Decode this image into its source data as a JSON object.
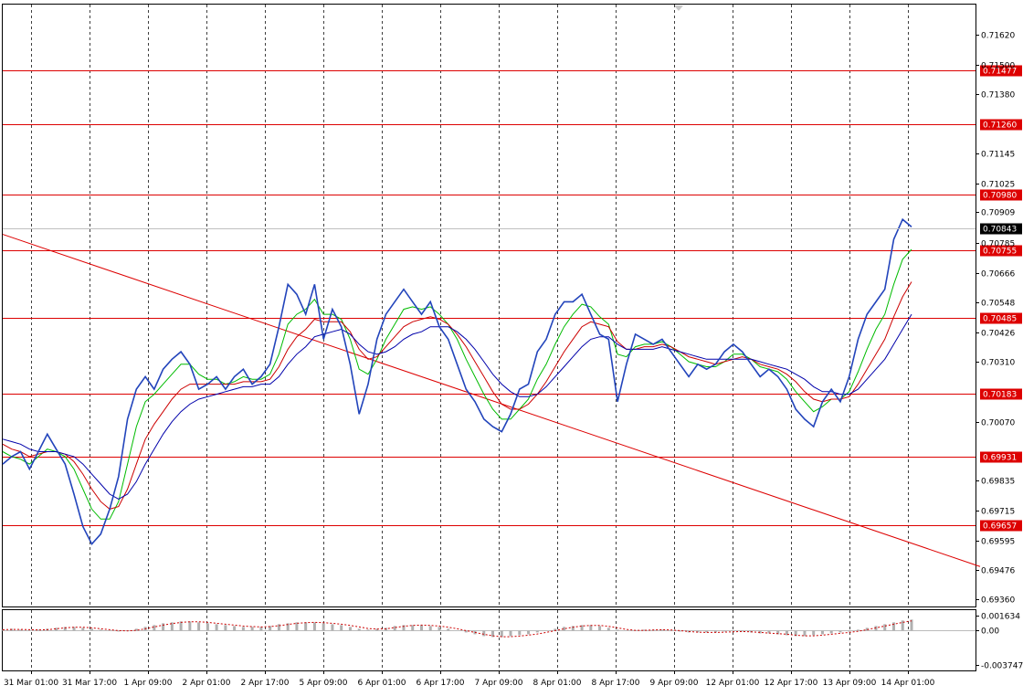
{
  "chart_data": {
    "type": "line",
    "title": "",
    "price_ticks": [
      "0.71620",
      "0.71500",
      "0.71380",
      "0.71145",
      "0.71025",
      "0.70909",
      "0.70785",
      "0.70666",
      "0.70548",
      "0.70426",
      "0.70310",
      "0.70070",
      "0.69835",
      "0.69715",
      "0.69595",
      "0.69476",
      "0.69360"
    ],
    "price_levels": [
      {
        "label": "0.71477",
        "value": 0.71477
      },
      {
        "label": "0.71260",
        "value": 0.7126
      },
      {
        "label": "0.70980",
        "value": 0.7098
      },
      {
        "label": "0.70755",
        "value": 0.70755
      },
      {
        "label": "0.70485",
        "value": 0.70485
      },
      {
        "label": "0.70183",
        "value": 0.70183
      },
      {
        "label": "0.69931",
        "value": 0.69931
      },
      {
        "label": "0.69657",
        "value": 0.69657
      }
    ],
    "current_price": {
      "label": "0.70843",
      "value": 0.70843
    },
    "trendline": {
      "from": {
        "x": "31 Mar 01:00",
        "y": 0.7082
      },
      "to": {
        "x": "14 Apr 01:00",
        "y": 0.6949
      }
    },
    "x_labels": [
      "31 Mar 01:00",
      "31 Mar 17:00",
      "1 Apr 09:00",
      "2 Apr 01:00",
      "2 Apr 17:00",
      "5 Apr 09:00",
      "6 Apr 01:00",
      "6 Apr 17:00",
      "7 Apr 09:00",
      "8 Apr 01:00",
      "8 Apr 17:00",
      "9 Apr 09:00",
      "12 Apr 01:00",
      "12 Apr 17:00",
      "13 Apr 09:00",
      "14 Apr 01:00"
    ],
    "series": [
      {
        "color": "#2244bb",
        "values": [
          0.699,
          0.6993,
          0.6995,
          0.6988,
          0.6995,
          0.7002,
          0.6996,
          0.699,
          0.6978,
          0.6965,
          0.6958,
          0.6962,
          0.6972,
          0.6985,
          0.7008,
          0.702,
          0.7025,
          0.702,
          0.7028,
          0.7032,
          0.7035,
          0.703,
          0.702,
          0.7022,
          0.7025,
          0.702,
          0.7025,
          0.7028,
          0.7022,
          0.7025,
          0.703,
          0.7045,
          0.7062,
          0.7058,
          0.705,
          0.7062,
          0.704,
          0.7052,
          0.7045,
          0.703,
          0.701,
          0.7022,
          0.704,
          0.705,
          0.7055,
          0.706,
          0.7055,
          0.705,
          0.7055,
          0.7045,
          0.704,
          0.703,
          0.702,
          0.7015,
          0.7008,
          0.7005,
          0.7003,
          0.701,
          0.702,
          0.7022,
          0.7035,
          0.704,
          0.705,
          0.7055,
          0.7055,
          0.7058,
          0.705,
          0.7042,
          0.704,
          0.7015,
          0.703,
          0.7042,
          0.704,
          0.7038,
          0.704,
          0.7035,
          0.703,
          0.7025,
          0.703,
          0.7028,
          0.703,
          0.7035,
          0.7038,
          0.7035,
          0.703,
          0.7025,
          0.7028,
          0.7025,
          0.702,
          0.7012,
          0.7008,
          0.7005,
          0.7015,
          0.702,
          0.7015,
          0.7025,
          0.704,
          0.705,
          0.7055,
          0.706,
          0.708,
          0.7088,
          0.7085
        ]
      },
      {
        "color": "#00bb00",
        "values": [
          0.6995,
          0.6993,
          0.6992,
          0.699,
          0.6993,
          0.6996,
          0.6995,
          0.6993,
          0.6988,
          0.698,
          0.6972,
          0.6968,
          0.6968,
          0.6975,
          0.699,
          0.7005,
          0.7015,
          0.7018,
          0.7022,
          0.7026,
          0.703,
          0.703,
          0.7026,
          0.7024,
          0.7024,
          0.7022,
          0.7023,
          0.7025,
          0.7024,
          0.7024,
          0.7026,
          0.7034,
          0.7046,
          0.705,
          0.7052,
          0.7056,
          0.705,
          0.705,
          0.7048,
          0.704,
          0.7028,
          0.7026,
          0.7032,
          0.704,
          0.7046,
          0.7052,
          0.7053,
          0.7052,
          0.7053,
          0.705,
          0.7046,
          0.704,
          0.7032,
          0.7025,
          0.7018,
          0.7012,
          0.7008,
          0.7008,
          0.7012,
          0.7016,
          0.7024,
          0.703,
          0.7038,
          0.7045,
          0.705,
          0.7054,
          0.7053,
          0.7049,
          0.7046,
          0.7034,
          0.7033,
          0.7037,
          0.7038,
          0.7038,
          0.7039,
          0.7037,
          0.7034,
          0.7031,
          0.703,
          0.7029,
          0.7029,
          0.7031,
          0.7034,
          0.7034,
          0.7032,
          0.7029,
          0.7028,
          0.7027,
          0.7024,
          0.7019,
          0.7015,
          0.7011,
          0.7013,
          0.7016,
          0.7016,
          0.7019,
          0.7027,
          0.7036,
          0.7044,
          0.705,
          0.7062,
          0.7072,
          0.7076
        ]
      },
      {
        "color": "#cc0000",
        "values": [
          0.6998,
          0.6996,
          0.6995,
          0.6993,
          0.6994,
          0.6995,
          0.6995,
          0.6994,
          0.6991,
          0.6986,
          0.698,
          0.6975,
          0.6972,
          0.6973,
          0.698,
          0.699,
          0.7,
          0.7006,
          0.7011,
          0.7016,
          0.702,
          0.7022,
          0.7022,
          0.7022,
          0.7022,
          0.7022,
          0.7022,
          0.7023,
          0.7023,
          0.7023,
          0.7024,
          0.7029,
          0.7036,
          0.7041,
          0.7044,
          0.7048,
          0.7047,
          0.7047,
          0.7047,
          0.7043,
          0.7036,
          0.7032,
          0.7033,
          0.7037,
          0.7041,
          0.7045,
          0.7047,
          0.7048,
          0.7049,
          0.7048,
          0.7046,
          0.7042,
          0.7037,
          0.7031,
          0.7025,
          0.7019,
          0.7014,
          0.7012,
          0.7012,
          0.7014,
          0.7018,
          0.7023,
          0.7029,
          0.7035,
          0.704,
          0.7045,
          0.7047,
          0.7046,
          0.7045,
          0.7039,
          0.7036,
          0.7036,
          0.7037,
          0.7037,
          0.7038,
          0.7037,
          0.7035,
          0.7033,
          0.7032,
          0.7031,
          0.703,
          0.7031,
          0.7032,
          0.7033,
          0.7032,
          0.703,
          0.7029,
          0.7028,
          0.7026,
          0.7023,
          0.7019,
          0.7016,
          0.7015,
          0.7016,
          0.7016,
          0.7017,
          0.7022,
          0.7028,
          0.7034,
          0.704,
          0.7049,
          0.7057,
          0.7063
        ]
      },
      {
        "color": "#0000aa",
        "values": [
          0.7,
          0.6999,
          0.6998,
          0.6996,
          0.6995,
          0.6995,
          0.6995,
          0.6994,
          0.6993,
          0.699,
          0.6986,
          0.6982,
          0.6978,
          0.6976,
          0.6978,
          0.6983,
          0.699,
          0.6996,
          0.7002,
          0.7007,
          0.7011,
          0.7014,
          0.7016,
          0.7017,
          0.7018,
          0.7019,
          0.702,
          0.7021,
          0.7021,
          0.7022,
          0.7022,
          0.7025,
          0.703,
          0.7034,
          0.7037,
          0.7041,
          0.7042,
          0.7043,
          0.7044,
          0.7042,
          0.7038,
          0.7035,
          0.7034,
          0.7035,
          0.7037,
          0.704,
          0.7042,
          0.7043,
          0.7045,
          0.7045,
          0.7045,
          0.7043,
          0.704,
          0.7036,
          0.7031,
          0.7026,
          0.7022,
          0.7019,
          0.7017,
          0.7017,
          0.7018,
          0.7021,
          0.7025,
          0.7029,
          0.7033,
          0.7037,
          0.704,
          0.7041,
          0.7041,
          0.7038,
          0.7036,
          0.7036,
          0.7036,
          0.7036,
          0.7037,
          0.7036,
          0.7035,
          0.7034,
          0.7033,
          0.7032,
          0.7032,
          0.7032,
          0.7032,
          0.7032,
          0.7032,
          0.7031,
          0.703,
          0.7029,
          0.7028,
          0.7026,
          0.7024,
          0.7021,
          0.7019,
          0.7019,
          0.7018,
          0.7018,
          0.702,
          0.7024,
          0.7028,
          0.7032,
          0.7038,
          0.7044,
          0.705
        ]
      }
    ],
    "oscillator": {
      "ticks": [
        "0.001634",
        "0.00",
        "-0.003747"
      ],
      "ylim": [
        -0.003747,
        0.001634
      ],
      "values": [
        0.0001,
        0.0002,
        0.0001,
        0.0,
        0.0001,
        0.0002,
        0.0003,
        0.0004,
        0.0004,
        0.0003,
        0.0002,
        0.0001,
        0.0,
        -0.0001,
        0.0,
        0.0002,
        0.0004,
        0.0006,
        0.0008,
        0.0009,
        0.001,
        0.001,
        0.0009,
        0.0008,
        0.0007,
        0.0006,
        0.0005,
        0.0004,
        0.0004,
        0.0004,
        0.0005,
        0.0007,
        0.0008,
        0.0009,
        0.0009,
        0.0009,
        0.0008,
        0.0007,
        0.0006,
        0.0004,
        0.0002,
        0.0001,
        0.0002,
        0.0003,
        0.0005,
        0.0006,
        0.0006,
        0.0006,
        0.0005,
        0.0004,
        0.0002,
        0.0,
        -0.0002,
        -0.0004,
        -0.0006,
        -0.0007,
        -0.0007,
        -0.0006,
        -0.0005,
        -0.0004,
        -0.0002,
        0.0,
        0.0002,
        0.0004,
        0.0005,
        0.0006,
        0.0006,
        0.0005,
        0.0003,
        0.0001,
        0.0,
        0.0,
        0.0001,
        0.0001,
        0.0001,
        0.0,
        -0.0001,
        -0.0002,
        -0.0002,
        -0.0002,
        -0.0002,
        -0.0001,
        -0.0001,
        -0.0001,
        -0.0002,
        -0.0003,
        -0.0003,
        -0.0004,
        -0.0005,
        -0.0006,
        -0.0006,
        -0.0005,
        -0.0004,
        -0.0003,
        -0.0002,
        -0.0001,
        0.0001,
        0.0003,
        0.0005,
        0.0007,
        0.0009,
        0.0011,
        0.0012
      ]
    }
  }
}
